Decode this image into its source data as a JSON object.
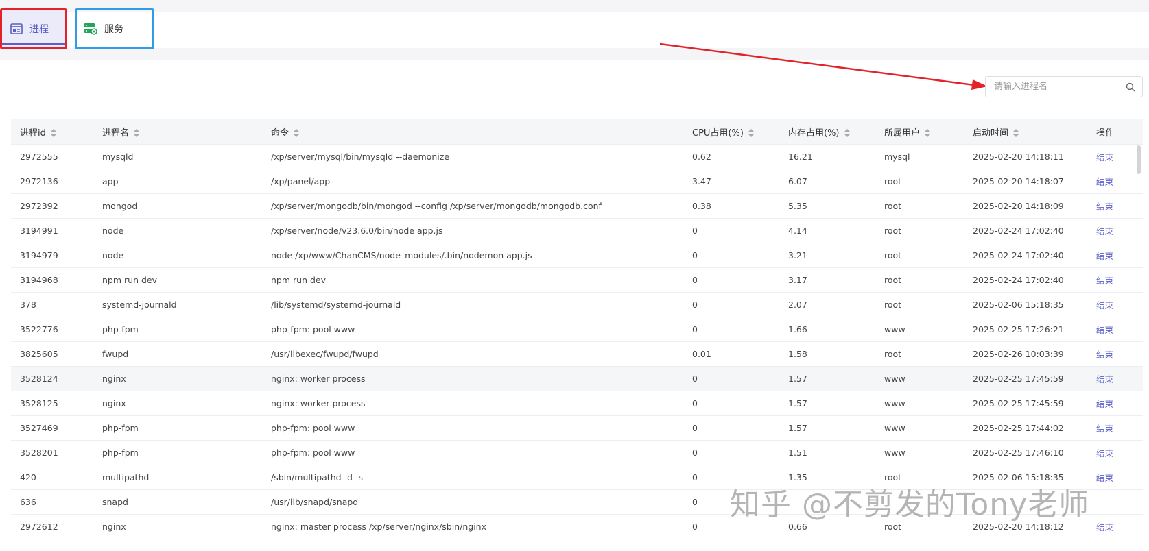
{
  "tabs": [
    {
      "label": "进程",
      "active": true
    },
    {
      "label": "服务",
      "active": false
    }
  ],
  "search": {
    "placeholder": "请输入进程名"
  },
  "table": {
    "columns": [
      "进程id",
      "进程名",
      "命令",
      "CPU占用(%)",
      "内存占用(%)",
      "所属用户",
      "启动时间",
      "操作"
    ],
    "rows": [
      [
        "2972555",
        "mysqld",
        "/xp/server/mysql/bin/mysqld --daemonize",
        "0.62",
        "16.21",
        "mysql",
        "2025-02-20 14:18:11",
        "结束"
      ],
      [
        "2972136",
        "app",
        "/xp/panel/app",
        "3.47",
        "6.07",
        "root",
        "2025-02-20 14:18:07",
        "结束"
      ],
      [
        "2972392",
        "mongod",
        "/xp/server/mongodb/bin/mongod --config /xp/server/mongodb/mongodb.conf",
        "0.38",
        "5.35",
        "root",
        "2025-02-20 14:18:09",
        "结束"
      ],
      [
        "3194991",
        "node",
        "/xp/server/node/v23.6.0/bin/node app.js",
        "0",
        "4.14",
        "root",
        "2025-02-24 17:02:40",
        "结束"
      ],
      [
        "3194979",
        "node",
        "node /xp/www/ChanCMS/node_modules/.bin/nodemon app.js",
        "0",
        "3.21",
        "root",
        "2025-02-24 17:02:40",
        "结束"
      ],
      [
        "3194968",
        "npm run dev",
        "npm run dev",
        "0",
        "3.17",
        "root",
        "2025-02-24 17:02:40",
        "结束"
      ],
      [
        "378",
        "systemd-journald",
        "/lib/systemd/systemd-journald",
        "0",
        "2.07",
        "root",
        "2025-02-06 15:18:35",
        "结束"
      ],
      [
        "3522776",
        "php-fpm",
        "php-fpm: pool www",
        "0",
        "1.66",
        "www",
        "2025-02-25 17:26:21",
        "结束"
      ],
      [
        "3825605",
        "fwupd",
        "/usr/libexec/fwupd/fwupd",
        "0.01",
        "1.58",
        "root",
        "2025-02-26 10:03:39",
        "结束"
      ],
      [
        "3528124",
        "nginx",
        "nginx: worker process",
        "0",
        "1.57",
        "www",
        "2025-02-25 17:45:59",
        "结束"
      ],
      [
        "3528125",
        "nginx",
        "nginx: worker process",
        "0",
        "1.57",
        "www",
        "2025-02-25 17:45:59",
        "结束"
      ],
      [
        "3527469",
        "php-fpm",
        "php-fpm: pool www",
        "0",
        "1.57",
        "www",
        "2025-02-25 17:44:02",
        "结束"
      ],
      [
        "3528201",
        "php-fpm",
        "php-fpm: pool www",
        "0",
        "1.51",
        "www",
        "2025-02-25 17:46:10",
        "结束"
      ],
      [
        "420",
        "multipathd",
        "/sbin/multipathd -d -s",
        "0",
        "1.35",
        "root",
        "2025-02-06 15:18:35",
        "结束"
      ],
      [
        "636",
        "snapd",
        "/usr/lib/snapd/snapd",
        "0",
        "",
        "",
        "",
        ""
      ],
      [
        "2972612",
        "nginx",
        "nginx: master process /xp/server/nginx/sbin/nginx",
        "0",
        "0.66",
        "root",
        "2025-02-20 14:18:12",
        "结束"
      ]
    ]
  },
  "watermark": "知乎 @不剪发的Tony老师",
  "colors": {
    "accent": "#5b5fc7",
    "annotation_red": "#e2232a",
    "annotation_blue": "#2f9ce5"
  }
}
